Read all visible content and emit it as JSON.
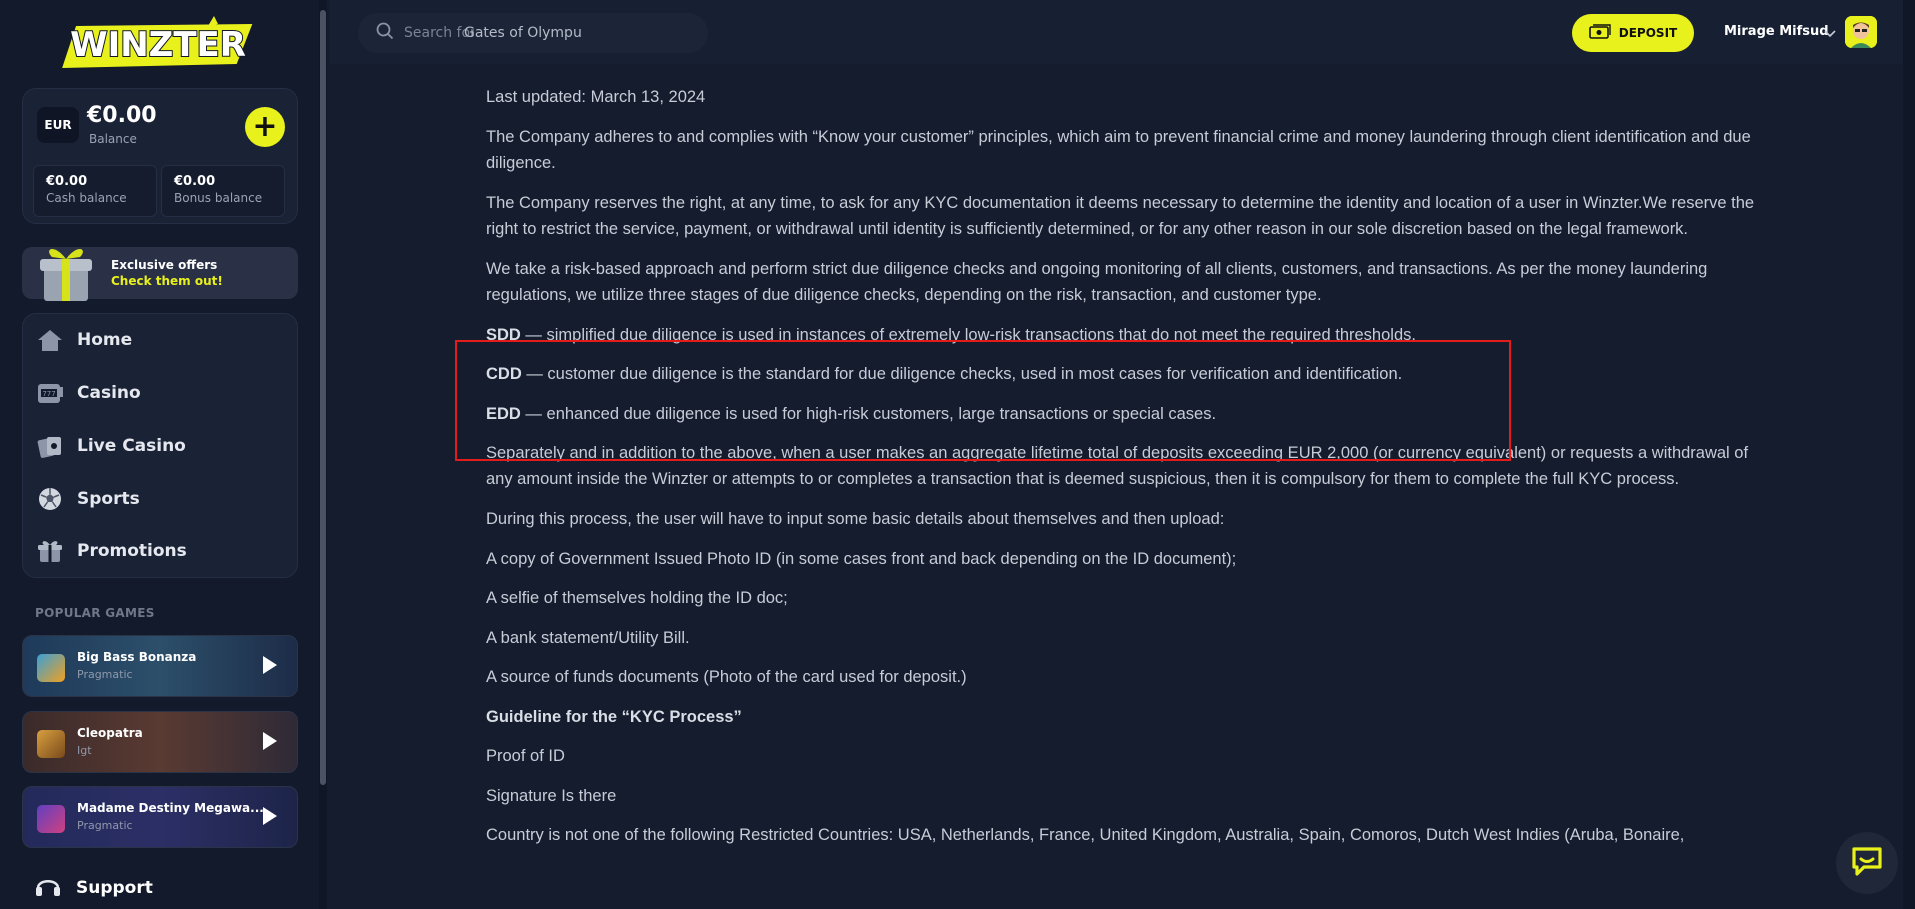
{
  "brand": {
    "logo_text": "WINZTER",
    "accent": "#e8f11c"
  },
  "balance": {
    "currency": "EUR",
    "amount": "€0.00",
    "label": "Balance",
    "cash_amount": "€0.00",
    "cash_label": "Cash balance",
    "bonus_amount": "€0.00",
    "bonus_label": "Bonus balance"
  },
  "offers": {
    "title": "Exclusive offers",
    "cta": "Check them out!"
  },
  "nav": {
    "items": [
      {
        "label": "Home",
        "icon": "home-icon"
      },
      {
        "label": "Casino",
        "icon": "slot-machine-icon"
      },
      {
        "label": "Live Casino",
        "icon": "cards-icon"
      },
      {
        "label": "Sports",
        "icon": "soccer-ball-icon"
      },
      {
        "label": "Promotions",
        "icon": "gift-icon"
      }
    ]
  },
  "popular": {
    "title": "POPULAR GAMES",
    "games": [
      {
        "name": "Big Bass Bonanza",
        "provider": "Pragmatic"
      },
      {
        "name": "Cleopatra",
        "provider": "Igt"
      },
      {
        "name": "Madame Destiny Megawa...",
        "provider": "Pragmatic"
      }
    ]
  },
  "support": {
    "label": "Support"
  },
  "header": {
    "search_prefix": "Search for",
    "search_placeholder": "Gates of Olympu",
    "deposit_label": "DEPOSIT",
    "user_name": "Mirage Mifsud"
  },
  "article": {
    "updated": "Last updated: March 13, 2024",
    "p1": "The Company adheres to and complies with “Know your customer” principles, which aim to prevent financial crime and money laundering through client identification and due diligence.",
    "p2": "The Company reserves the right, at any time, to ask for any KYC documentation it deems necessary to determine the identity and location of a user in Winzter.We reserve the right to restrict the service, payment, or withdrawal until identity is sufficiently determined, or for any other reason in our sole discretion based on the legal framework.",
    "p3": "We take a risk-based approach and perform strict due diligence checks and ongoing monitoring of all clients, customers, and transactions. As per the money laundering regulations, we utilize three stages of due diligence checks, depending on the risk, transaction, and customer type.",
    "sdd_term": "SDD",
    "sdd_text": " — simplified due diligence is used in instances of extremely low-risk transactions that do not meet the required thresholds.",
    "cdd_term": "CDD",
    "cdd_text": " — customer due diligence is the standard for due diligence checks, used in most cases for verification and identification.",
    "edd_term": "EDD",
    "edd_text": " — enhanced due diligence is used for high-risk customers, large transactions or special cases.",
    "p4": "Separately and in addition to the above, when a user makes an aggregate lifetime total of deposits exceeding EUR 2,000 (or currency equivalent) or requests a withdrawal of any amount inside the Winzter or attempts to or completes a transaction that is deemed suspicious, then it is compulsory for them to complete the full KYC process.",
    "p5": "During this process, the user will have to input some basic details about themselves and then upload:",
    "l1": "A copy of Government Issued Photo ID (in some cases front and back depending on the ID document);",
    "l2": "A selfie of themselves holding the ID doc;",
    "l3": "A bank statement/Utility Bill.",
    "l4": "A source of funds documents (Photo of the card used for deposit.)",
    "guideline": "Guideline for the “KYC Process”",
    "g1": "Proof of ID",
    "g2": "Signature Is there",
    "g3": "Country is not one of the following Restricted Countries: USA, Netherlands, France, United Kingdom, Australia, Spain, Comoros, Dutch West Indies (Aruba, Bonaire,"
  }
}
